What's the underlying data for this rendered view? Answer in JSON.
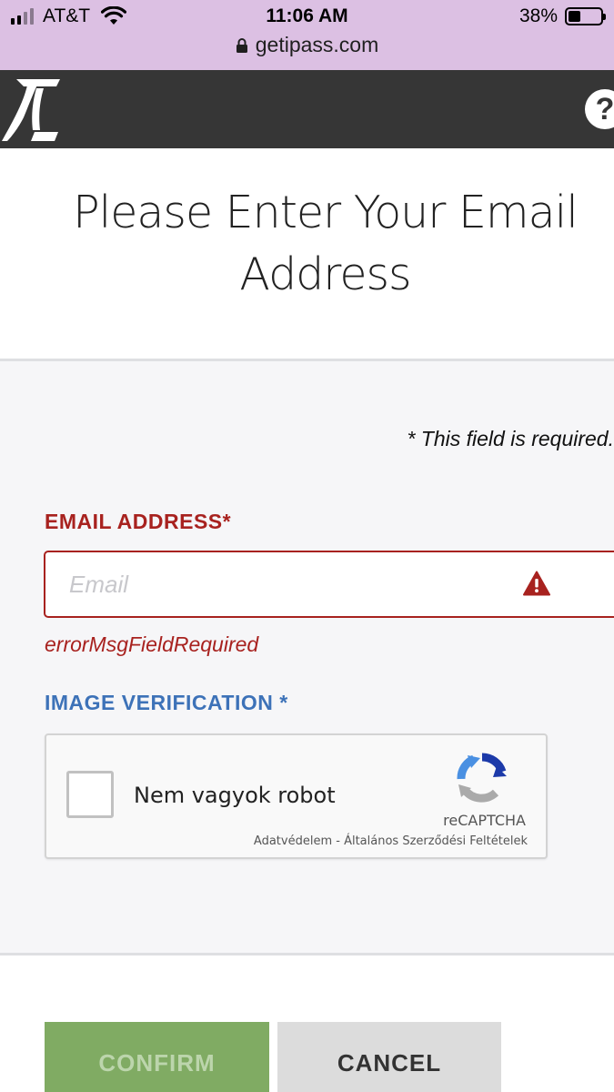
{
  "status_bar": {
    "carrier": "AT&T",
    "time": "11:06 AM",
    "battery_percent": "38%",
    "battery_level": 0.38,
    "signal_bars_filled": 2,
    "signal_bars_total": 4,
    "url": "getipass.com",
    "background_color": "#dcc0e3"
  },
  "header": {
    "background_color": "#363636",
    "logo_icon": "ipass-logo",
    "help_icon": "question-circle-icon",
    "help_label": "?"
  },
  "page": {
    "title": "Please Enter Your Email Address"
  },
  "form": {
    "required_note": "* This field is required.",
    "email": {
      "label": "EMAIL ADDRESS",
      "required_marker": "*",
      "placeholder": "Email",
      "value": "",
      "error_icon": "warning-triangle-icon",
      "error_message": "errorMsgFieldRequired",
      "error_color": "#a8221f"
    },
    "image_verification": {
      "label": "IMAGE VERIFICATION *",
      "label_color": "#3d72b8"
    },
    "recaptcha": {
      "checkbox_label": "Nem vagyok robot",
      "checked": false,
      "brand": "reCAPTCHA",
      "privacy_link": "Adatvédelem",
      "separator": " - ",
      "terms_link": "Általános Szerződési Feltételek",
      "logo_icon": "recaptcha-logo-icon"
    }
  },
  "buttons": {
    "confirm": "CONFIRM",
    "cancel": "CANCEL",
    "confirm_color": "#80ab63",
    "cancel_color": "#dcdcdc"
  }
}
